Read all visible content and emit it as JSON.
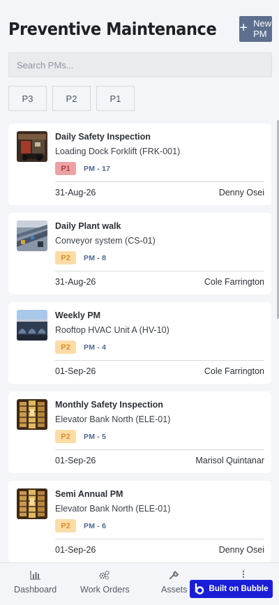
{
  "header": {
    "title": "Preventive Maintenance",
    "new_button_label": "New PM",
    "new_button_icon": "plus-icon"
  },
  "search": {
    "placeholder": "Search PMs..."
  },
  "filters": [
    "P3",
    "P2",
    "P1"
  ],
  "pms": [
    {
      "title": "Daily Safety Inspection",
      "asset": "Loading Dock Forklift (FRK-001)",
      "priority": "P1",
      "pm_id": "PM - 17",
      "date": "31-Aug-26",
      "assignee": "Denny Osei"
    },
    {
      "title": "Daily Plant walk",
      "asset": "Conveyor system (CS-01)",
      "priority": "P2",
      "pm_id": "PM - 8",
      "date": "31-Aug-26",
      "assignee": "Cole Farrington"
    },
    {
      "title": "Weekly PM",
      "asset": "Rooftop HVAC Unit A (HV-10)",
      "priority": "P2",
      "pm_id": "PM - 4",
      "date": "01-Sep-26",
      "assignee": "Cole Farrington"
    },
    {
      "title": "Monthly Safety Inspection",
      "asset": "Elevator Bank North (ELE-01)",
      "priority": "P2",
      "pm_id": "PM - 5",
      "date": "01-Sep-26",
      "assignee": "Marisol Quintanar"
    },
    {
      "title": "Semi Annual PM",
      "asset": "Elevator Bank North (ELE-01)",
      "priority": "P2",
      "pm_id": "PM - 6",
      "date": "01-Sep-26",
      "assignee": "Denny Osei"
    }
  ],
  "nav": {
    "dashboard": {
      "label": "Dashboard",
      "icon": "bar-chart-icon"
    },
    "work_orders": {
      "label": "Work Orders",
      "icon": "gears-icon"
    },
    "assets": {
      "label": "Assets",
      "icon": "wrench-icon"
    },
    "more": {
      "icon": "more-vertical-icon"
    }
  },
  "bubble_badge": {
    "label": "Built on Bubble"
  },
  "colors": {
    "accent": "#5c6f8e",
    "p1_bg": "#eaa3a4",
    "p2_bg": "#fcdca6",
    "badge_blue": "#1a1ed6"
  }
}
